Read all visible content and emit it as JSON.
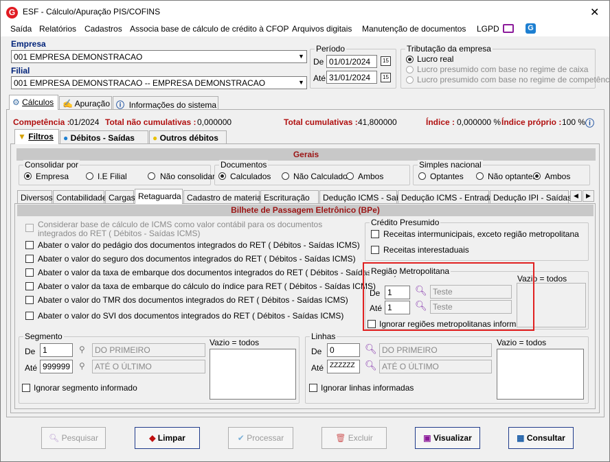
{
  "window": {
    "title": "ESF - Cálculo/Apuração PIS/COFINS",
    "logo": "G",
    "close": "✕"
  },
  "menu": [
    "Saída",
    "Relatórios",
    "Cadastros",
    "Associa base de cálculo de crédito à CFOP",
    "Arquivos digitais",
    "Manutenção de documentos",
    "LGPD"
  ],
  "empresa": {
    "label": "Empresa",
    "value": "001 EMPRESA DEMONSTRACAO"
  },
  "filial": {
    "label": "Filial",
    "value": "001 EMPRESA DEMONSTRACAO -- EMPRESA DEMONSTRACAO"
  },
  "periodo": {
    "label": "Período",
    "de_label": "De",
    "de": "01/01/2024",
    "ate_label": "Até",
    "ate": "31/01/2024",
    "cal": "15"
  },
  "tributacao": {
    "label": "Tributação da empresa",
    "options": [
      "Lucro real",
      "Lucro presumido com base no regime de caixa",
      "Lucro presumido com base no regime de competência"
    ]
  },
  "main_tabs": [
    "Cálculos",
    "Apuração",
    "Informações do sistema"
  ],
  "status": {
    "competencia_label": "Competência :",
    "competencia": "01/2024",
    "nao_cum_label": "Total não cumulativas :",
    "nao_cum": "0,000000",
    "cum_label": "Total cumulativas :",
    "cum": "41,800000",
    "indice_label": "Índice :",
    "indice": "0,000000 %",
    "indice_proprio_label": "Índice próprio :",
    "indice_proprio": "100 %"
  },
  "sub_tabs": [
    "Filtros",
    "Débitos - Saídas",
    "Outros débitos"
  ],
  "gerais": {
    "title": "Gerais",
    "consolidar": {
      "label": "Consolidar por",
      "options": [
        "Empresa",
        "I.E Filial",
        "Não consolidar"
      ]
    },
    "documentos": {
      "label": "Documentos",
      "options": [
        "Calculados",
        "Não Calculados",
        "Ambos"
      ]
    },
    "simples": {
      "label": "Simples nacional",
      "options": [
        "Optantes",
        "Não optantes",
        "Ambos"
      ]
    }
  },
  "filter_tabs": [
    "Diversos",
    "Contabilidade",
    "Cargas",
    "Retaguarda",
    "Cadastro de materiais",
    "Escrituração",
    "Dedução ICMS - Saídas",
    "Dedução ICMS - Entradas",
    "Dedução IPI - Saídas"
  ],
  "bpe": {
    "title": "Bilhete de Passagem Eletrônico (BPe)",
    "options": [
      "Considerar base de cálculo de ICMS como valor contábil para os documentos integrados do RET ( Débitos - Saídas ICMS)",
      "Abater o valor do pedágio dos documentos integrados do RET ( Débitos - Saídas ICMS)",
      "Abater o valor do seguro dos documentos integrados do RET ( Débitos - Saídas ICMS)",
      "Abater o valor da taxa de embarque dos documentos integrados do RET ( Débitos - Saídas ICMS)",
      "Abater o valor da taxa de embarque do cálculo do índice para RET ( Débitos - Saídas ICMS)",
      "Abater o valor do TMR dos documentos integrados do RET ( Débitos - Saídas ICMS)",
      "Abater o valor do SVI dos documentos integrados do RET ( Débitos - Saídas ICMS)"
    ]
  },
  "credito": {
    "label": "Crédito Presumido",
    "options": [
      "Receitas intermunicipais, exceto região metropolitana",
      "Receitas interestaduais"
    ]
  },
  "regiao": {
    "label": "Região Metropolitana",
    "de_label": "De",
    "de": "1",
    "de_desc": "Teste",
    "ate_label": "Até",
    "ate": "1",
    "ate_desc": "Teste",
    "ignore": "Ignorar regiões metropolitanas informadas",
    "vazio": "Vazio = todos"
  },
  "segmento": {
    "label": "Segmento",
    "de_label": "De",
    "de": "1",
    "de_desc": "DO PRIMEIRO",
    "ate_label": "Até",
    "ate": "999999",
    "ate_desc": "ATÉ O ÚLTIMO",
    "ignore": "Ignorar segmento informado",
    "vazio": "Vazio = todos"
  },
  "linhas": {
    "label": "Linhas",
    "de_label": "De",
    "de": "0",
    "de_desc": "DO PRIMEIRO",
    "ate_label": "Até",
    "ate": "ZZZZZZ",
    "ate_desc": "ATÉ O ÚLTIMO",
    "ignore": "Ignorar linhas informadas",
    "vazio": "Vazio = todos"
  },
  "buttons": [
    "Pesquisar",
    "Limpar",
    "Processar",
    "Excluir",
    "Visualizar",
    "Consultar"
  ],
  "colors": {
    "highlight": "#e02020",
    "status_red": "#b01010",
    "section_head": "#c8c8c8"
  }
}
